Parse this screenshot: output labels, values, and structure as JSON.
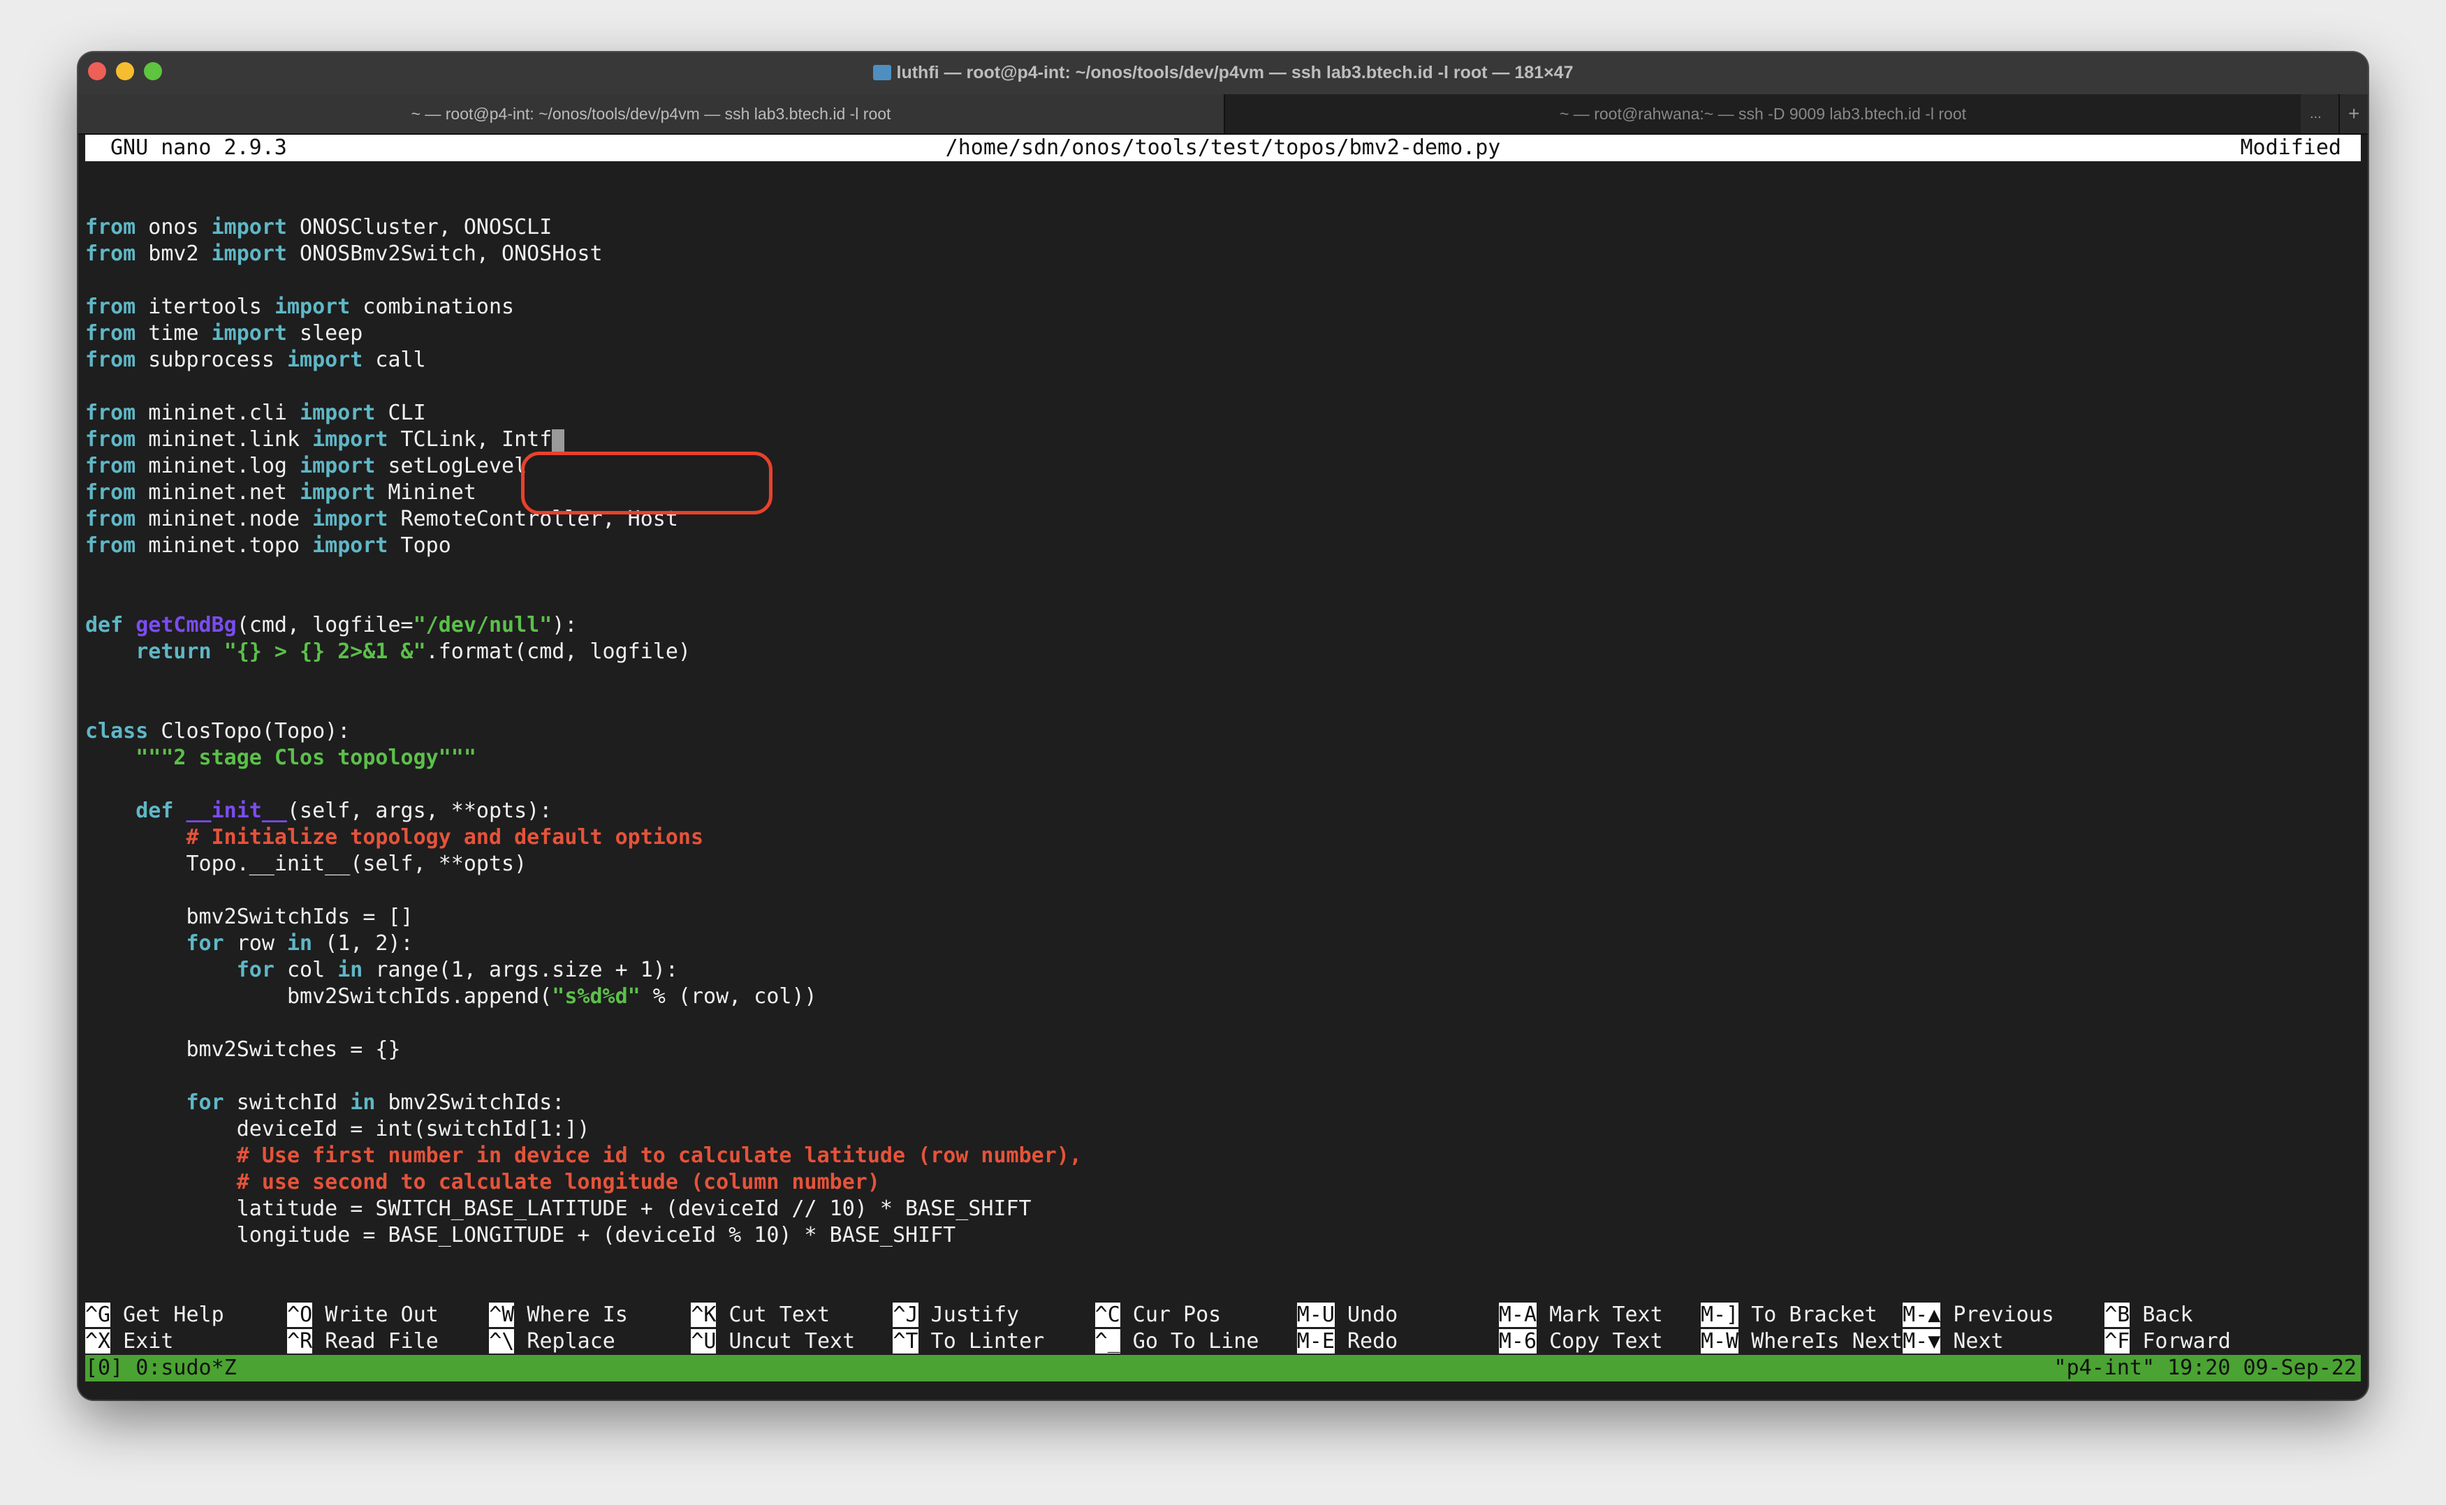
{
  "window": {
    "title": "luthfi — root@p4-int: ~/onos/tools/dev/p4vm — ssh lab3.btech.id -l root — 181×47",
    "traffic_lights": [
      "#ee5f57",
      "#f5bd2f",
      "#5fc43f"
    ],
    "tabs": [
      {
        "label": "~ — root@p4-int: ~/onos/tools/dev/p4vm — ssh lab3.btech.id -l root",
        "active": true
      },
      {
        "label": "~ — root@rahwana:~ — ssh -D 9009 lab3.btech.id -l root",
        "active": false
      }
    ],
    "tab_overflow": "...",
    "new_tab": "+"
  },
  "nano": {
    "version": "GNU nano 2.9.3",
    "file_path": "/home/sdn/onos/tools/test/topos/bmv2-demo.py",
    "state": "Modified"
  },
  "colors": {
    "keyword": "#5fb7c6",
    "function": "#7b4cf0",
    "string": "#5cc04a",
    "comment": "#e5533a",
    "status_bar": "#4aa332",
    "annotation": "#e8412c"
  },
  "code": [
    [],
    [],
    [
      [
        "k",
        "from"
      ],
      [
        "n",
        " onos "
      ],
      [
        "k",
        "import"
      ],
      [
        "n",
        " ONOSCluster, ONOSCLI"
      ]
    ],
    [
      [
        "k",
        "from"
      ],
      [
        "n",
        " bmv2 "
      ],
      [
        "k",
        "import"
      ],
      [
        "n",
        " ONOSBmv2Switch, ONOSHost"
      ]
    ],
    [],
    [
      [
        "k",
        "from"
      ],
      [
        "n",
        " itertools "
      ],
      [
        "k",
        "import"
      ],
      [
        "n",
        " combinations"
      ]
    ],
    [
      [
        "k",
        "from"
      ],
      [
        "n",
        " time "
      ],
      [
        "k",
        "import"
      ],
      [
        "n",
        " sleep"
      ]
    ],
    [
      [
        "k",
        "from"
      ],
      [
        "n",
        " subprocess "
      ],
      [
        "k",
        "import"
      ],
      [
        "n",
        " call"
      ]
    ],
    [],
    [
      [
        "k",
        "from"
      ],
      [
        "n",
        " mininet.cli "
      ],
      [
        "k",
        "import"
      ],
      [
        "n",
        " CLI"
      ]
    ],
    [
      [
        "k",
        "from"
      ],
      [
        "n",
        " mininet.link "
      ],
      [
        "k",
        "import"
      ],
      [
        "n",
        " TCLink, Intf"
      ],
      [
        "cursor",
        ""
      ]
    ],
    [
      [
        "k",
        "from"
      ],
      [
        "n",
        " mininet.log "
      ],
      [
        "k",
        "import"
      ],
      [
        "n",
        " setLogLevel"
      ]
    ],
    [
      [
        "k",
        "from"
      ],
      [
        "n",
        " mininet.net "
      ],
      [
        "k",
        "import"
      ],
      [
        "n",
        " Mininet"
      ]
    ],
    [
      [
        "k",
        "from"
      ],
      [
        "n",
        " mininet.node "
      ],
      [
        "k",
        "import"
      ],
      [
        "n",
        " RemoteController, Host"
      ]
    ],
    [
      [
        "k",
        "from"
      ],
      [
        "n",
        " mininet.topo "
      ],
      [
        "k",
        "import"
      ],
      [
        "n",
        " Topo"
      ]
    ],
    [],
    [],
    [
      [
        "k",
        "def"
      ],
      [
        "n",
        " "
      ],
      [
        "f",
        "getCmdBg"
      ],
      [
        "n",
        "(cmd, logfile="
      ],
      [
        "s",
        "\"/dev/null\""
      ],
      [
        "n",
        "):"
      ]
    ],
    [
      [
        "n",
        "    "
      ],
      [
        "k",
        "return"
      ],
      [
        "n",
        " "
      ],
      [
        "s",
        "\"{} > {} 2>&1 &\""
      ],
      [
        "n",
        ".format(cmd, logfile)"
      ]
    ],
    [],
    [],
    [
      [
        "k",
        "class"
      ],
      [
        "n",
        " ClosTopo(Topo):"
      ]
    ],
    [
      [
        "n",
        "    "
      ],
      [
        "s",
        "\"\"\"2 stage Clos topology\"\"\""
      ]
    ],
    [],
    [
      [
        "n",
        "    "
      ],
      [
        "k",
        "def"
      ],
      [
        "n",
        " "
      ],
      [
        "f",
        "__init__"
      ],
      [
        "n",
        "(self, args, **opts):"
      ]
    ],
    [
      [
        "n",
        "        "
      ],
      [
        "c",
        "# Initialize topology and default options"
      ]
    ],
    [
      [
        "n",
        "        Topo.__init__(self, **opts)"
      ]
    ],
    [],
    [
      [
        "n",
        "        bmv2SwitchIds = []"
      ]
    ],
    [
      [
        "n",
        "        "
      ],
      [
        "k",
        "for"
      ],
      [
        "n",
        " row "
      ],
      [
        "k",
        "in"
      ],
      [
        "n",
        " (1, 2):"
      ]
    ],
    [
      [
        "n",
        "            "
      ],
      [
        "k",
        "for"
      ],
      [
        "n",
        " col "
      ],
      [
        "k",
        "in"
      ],
      [
        "n",
        " range(1, args.size + 1):"
      ]
    ],
    [
      [
        "n",
        "                bmv2SwitchIds.append("
      ],
      [
        "s",
        "\"s%d%d\""
      ],
      [
        "n",
        " % (row, col))"
      ]
    ],
    [],
    [
      [
        "n",
        "        bmv2Switches = {}"
      ]
    ],
    [],
    [
      [
        "n",
        "        "
      ],
      [
        "k",
        "for"
      ],
      [
        "n",
        " switchId "
      ],
      [
        "k",
        "in"
      ],
      [
        "n",
        " bmv2SwitchIds:"
      ]
    ],
    [
      [
        "n",
        "            deviceId = int(switchId[1:])"
      ]
    ],
    [
      [
        "n",
        "            "
      ],
      [
        "c",
        "# Use first number in device id to calculate latitude (row number),"
      ]
    ],
    [
      [
        "n",
        "            "
      ],
      [
        "c",
        "# use second to calculate longitude (column number)"
      ]
    ],
    [
      [
        "n",
        "            latitude = SWITCH_BASE_LATITUDE + (deviceId // 10) * BASE_SHIFT"
      ]
    ],
    [
      [
        "n",
        "            longitude = BASE_LONGITUDE + (deviceId % 10) * BASE_SHIFT"
      ]
    ],
    [],
    []
  ],
  "shortcuts": [
    [
      {
        "key": "^G",
        "label": "Get Help"
      },
      {
        "key": "^O",
        "label": "Write Out"
      },
      {
        "key": "^W",
        "label": "Where Is"
      },
      {
        "key": "^K",
        "label": "Cut Text"
      },
      {
        "key": "^J",
        "label": "Justify"
      },
      {
        "key": "^C",
        "label": "Cur Pos"
      },
      {
        "key": "M-U",
        "label": "Undo"
      },
      {
        "key": "M-A",
        "label": "Mark Text"
      },
      {
        "key": "M-]",
        "label": "To Bracket"
      },
      {
        "key": "M-▲",
        "label": "Previous"
      },
      {
        "key": "^B",
        "label": "Back"
      }
    ],
    [
      {
        "key": "^X",
        "label": "Exit"
      },
      {
        "key": "^R",
        "label": "Read File"
      },
      {
        "key": "^\\",
        "label": "Replace"
      },
      {
        "key": "^U",
        "label": "Uncut Text"
      },
      {
        "key": "^T",
        "label": "To Linter"
      },
      {
        "key": "^_",
        "label": "Go To Line"
      },
      {
        "key": "M-E",
        "label": "Redo"
      },
      {
        "key": "M-6",
        "label": "Copy Text"
      },
      {
        "key": "M-W",
        "label": "WhereIs Next"
      },
      {
        "key": "M-▼",
        "label": "Next"
      },
      {
        "key": "^F",
        "label": "Forward"
      }
    ]
  ],
  "tmux": {
    "left": "[0] 0:sudo*Z",
    "right": "\"p4-int\" 19:20 09-Sep-22"
  }
}
